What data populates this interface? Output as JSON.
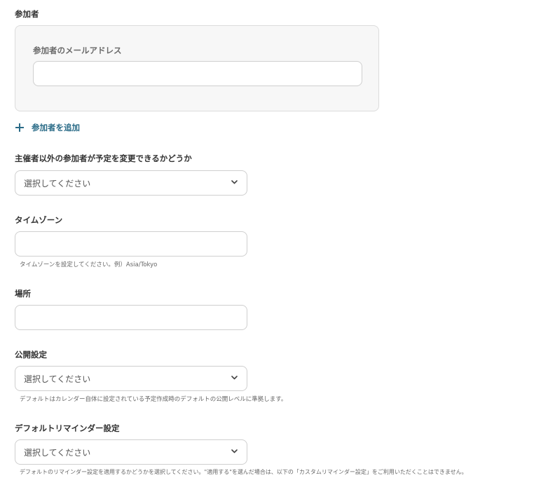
{
  "attendees": {
    "label": "参加者",
    "email_label": "参加者のメールアドレス",
    "email_value": "",
    "add_label": "参加者を追加"
  },
  "guests_can_modify": {
    "label": "主催者以外の参加者が予定を変更できるかどうか",
    "value": "選択してください"
  },
  "timezone": {
    "label": "タイムゾーン",
    "value": "",
    "hint": "タイムゾーンを設定してください。例）Asia/Tokyo"
  },
  "location": {
    "label": "場所",
    "value": ""
  },
  "visibility": {
    "label": "公開設定",
    "value": "選択してください",
    "hint": "デフォルトはカレンダー自体に設定されている予定作成時のデフォルトの公開レベルに準拠します。"
  },
  "default_reminder": {
    "label": "デフォルトリマインダー設定",
    "value": "選択してください",
    "hint": "デフォルトのリマインダー設定を適用するかどうかを選択してください。\"適用する\"を選んだ場合は、以下の「カスタムリマインダー設定」をご利用いただくことはできません。"
  },
  "icons": {
    "add": "plus-icon",
    "dropdown": "chevron-down-icon"
  },
  "colors": {
    "accent": "#2a6b87",
    "panel_bg": "#f7f7f7",
    "border": "#cfcfcf"
  }
}
